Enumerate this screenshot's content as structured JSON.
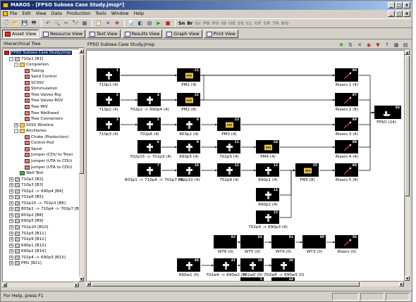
{
  "window": {
    "title": "MAROS - [FPSO Subsea Case Study.jmsp*]",
    "min": "_",
    "max": "□",
    "close": "x"
  },
  "menu": [
    "File",
    "Edit",
    "View",
    "Data",
    "Production",
    "Tools",
    "Window",
    "Help"
  ],
  "toolbar": {
    "icons": [
      "new-icon",
      "open-icon",
      "save-icon",
      "print-icon",
      "back-icon",
      "print-preview-icon",
      "cut-icon",
      "find-icon",
      "table-icon",
      "paste-icon",
      "tools-icon",
      "cross-icon",
      "chart-icon",
      "split-icon",
      "stack-icon",
      "run-icon",
      "stop-icon"
    ],
    "text_buttons": [
      {
        "label": "Sn",
        "enabled": true
      },
      {
        "label": "Br",
        "enabled": true
      },
      {
        "label": "Gr",
        "enabled": false
      },
      {
        "label": "PB",
        "enabled": false
      },
      {
        "label": "PU",
        "enabled": false
      },
      {
        "label": "IB",
        "enabled": false
      },
      {
        "label": "UE",
        "enabled": false
      },
      {
        "label": "SE",
        "enabled": false
      },
      {
        "label": "CL",
        "enabled": false
      },
      {
        "label": "UF",
        "enabled": false
      },
      {
        "label": "SR",
        "enabled": false
      },
      {
        "label": "TR",
        "enabled": false
      },
      {
        "label": "BO",
        "enabled": false
      }
    ]
  },
  "tabs": [
    "Asset View",
    "Resource View",
    "Text View",
    "Results View",
    "Graph View",
    "Print View"
  ],
  "active_tab": "Asset View",
  "left_pane": {
    "header": "Hierarchical Tree",
    "items": [
      {
        "label": "FPSO Subsea Case Study.jmsp",
        "indent": 0,
        "icon": "root",
        "expander": "",
        "selected": true
      },
      {
        "label": "710p1 [B1]",
        "indent": 1,
        "icon": "well",
        "expander": "-"
      },
      {
        "label": "Completion",
        "indent": 2,
        "icon": "fold",
        "expander": "-"
      },
      {
        "label": "Tubing",
        "indent": 3,
        "icon": "item",
        "expander": ""
      },
      {
        "label": "Sand Control",
        "indent": 3,
        "icon": "item",
        "expander": ""
      },
      {
        "label": "SCSSV",
        "indent": 3,
        "icon": "item",
        "expander": ""
      },
      {
        "label": "Stimmulation",
        "indent": 3,
        "icon": "item",
        "expander": ""
      },
      {
        "label": "Tree Valves Rig",
        "indent": 3,
        "icon": "item",
        "expander": ""
      },
      {
        "label": "Tree Valves ROV",
        "indent": 3,
        "icon": "item",
        "expander": ""
      },
      {
        "label": "Tree MIV",
        "indent": 3,
        "icon": "item",
        "expander": ""
      },
      {
        "label": "Tree Wellhead",
        "indent": 3,
        "icon": "item",
        "expander": ""
      },
      {
        "label": "Tree Connectors",
        "indent": 3,
        "icon": "item",
        "expander": ""
      },
      {
        "label": "SSSV Wireline",
        "indent": 2,
        "icon": "fold",
        "expander": "+"
      },
      {
        "label": "Ancillaries",
        "indent": 2,
        "icon": "fold",
        "expander": "-"
      },
      {
        "label": "Choke (Production)",
        "indent": 3,
        "icon": "item",
        "expander": ""
      },
      {
        "label": "Control Pod",
        "indent": 3,
        "icon": "item",
        "expander": ""
      },
      {
        "label": "Spool",
        "indent": 3,
        "icon": "item",
        "expander": ""
      },
      {
        "label": "Jumper (CDU to Tree)",
        "indent": 3,
        "icon": "item",
        "expander": ""
      },
      {
        "label": "Jumper (UTA to CDU)",
        "indent": 3,
        "icon": "item",
        "expander": ""
      },
      {
        "label": "Jumper (UTA to CDU)",
        "indent": 3,
        "icon": "item",
        "expander": ""
      },
      {
        "label": "Well Test",
        "indent": 2,
        "icon": "test",
        "expander": ""
      },
      {
        "label": "710p2 [B2]",
        "indent": 1,
        "icon": "well",
        "expander": "+"
      },
      {
        "label": "710p3 [B3]",
        "indent": 1,
        "icon": "well",
        "expander": "+"
      },
      {
        "label": "702p2 -> 690p4 [B4]",
        "indent": 1,
        "icon": "well",
        "expander": "+"
      },
      {
        "label": "702p6 [B5]",
        "indent": 1,
        "icon": "well",
        "expander": "+"
      },
      {
        "label": "702p15 -> 702p3 [B6]",
        "indent": 1,
        "icon": "well",
        "expander": "+"
      },
      {
        "label": "803p1 -> 710p4 -> 702p7 [B7",
        "indent": 1,
        "icon": "well",
        "expander": "+"
      },
      {
        "label": "803p2 [B8]",
        "indent": 1,
        "icon": "well",
        "expander": "+"
      },
      {
        "label": "690p5 [B9]",
        "indent": 1,
        "icon": "well",
        "expander": "+"
      },
      {
        "label": "702p10 [B10]",
        "indent": 1,
        "icon": "well",
        "expander": "+"
      },
      {
        "label": "702p5 [B11]",
        "indent": 1,
        "icon": "well",
        "expander": "+"
      },
      {
        "label": "702p9 [B12]",
        "indent": 1,
        "icon": "well",
        "expander": "+"
      },
      {
        "label": "690p1 [B13]",
        "indent": 1,
        "icon": "well",
        "expander": "+"
      },
      {
        "label": "690p2 [B14]",
        "indent": 1,
        "icon": "well",
        "expander": "+"
      },
      {
        "label": "702p4 -> 690p3 [B15]",
        "indent": 1,
        "icon": "well",
        "expander": "+"
      },
      {
        "label": "PM1 [B21]",
        "indent": 1,
        "icon": "well",
        "expander": "+"
      }
    ]
  },
  "right_pane": {
    "header": "FPSO Subsea Case Study.jmsp",
    "icons": [
      "green-x-icon",
      "sort-icon",
      "tools-icon",
      "help-icon",
      "red-down-icon",
      "up-icon",
      "grid-icon",
      "list-icon"
    ]
  },
  "nodes": [
    {
      "id": "n710p1",
      "badge": "1",
      "label": "710p1 (4)",
      "kind": "well"
    },
    {
      "id": "nPM1",
      "badge": "21",
      "label": "PM1 (4)",
      "kind": "manifold"
    },
    {
      "id": "nR1",
      "badge": "80",
      "label": "Risers 1 (4)",
      "kind": "riser"
    },
    {
      "id": "n710p2",
      "badge": "2",
      "label": "710p2 (4)",
      "kind": "well"
    },
    {
      "id": "n702p2",
      "badge": "4",
      "label": "702p2 -> 690p4 (4)",
      "kind": "well"
    },
    {
      "id": "nPM2",
      "badge": "22",
      "label": "PM2 (8)",
      "kind": "manifold"
    },
    {
      "id": "nR2",
      "badge": "87",
      "label": "Risers 2 (8)",
      "kind": "riser"
    },
    {
      "id": "n710p3",
      "badge": "3",
      "label": "710p3 (4)",
      "kind": "well"
    },
    {
      "id": "n702p6",
      "badge": "5",
      "label": "702p6 (4)",
      "kind": "well"
    },
    {
      "id": "n803p2",
      "badge": "8",
      "label": "803p2 (4)",
      "kind": "well"
    },
    {
      "id": "nPM3",
      "badge": "23",
      "label": "PM3 (4)",
      "kind": "manifold"
    },
    {
      "id": "nR3",
      "badge": "88",
      "label": "Risers 3 (4)",
      "kind": "riser"
    },
    {
      "id": "nFPSO",
      "badge": "84",
      "label": "FPSO (24)",
      "kind": "fpso"
    },
    {
      "id": "n702p15",
      "badge": "6",
      "label": "702p15 -> 702p3 (4)",
      "kind": "well"
    },
    {
      "id": "n690p5",
      "badge": "9",
      "label": "690p5 (4)",
      "kind": "well"
    },
    {
      "id": "n702p5",
      "badge": "11",
      "label": "702p5 (4)",
      "kind": "well"
    },
    {
      "id": "nPM4",
      "badge": "24",
      "label": "PM4 (4)",
      "kind": "manifold"
    },
    {
      "id": "nR4",
      "badge": "89",
      "label": "Risers 4 (4)",
      "kind": "riser"
    },
    {
      "id": "n803p1",
      "badge": "7",
      "label": "803p1 -> 710p4 -> 702p7 (4)",
      "kind": "well"
    },
    {
      "id": "n702p10",
      "badge": "10",
      "label": "702p10 (4)",
      "kind": "well"
    },
    {
      "id": "n702p9",
      "badge": "12",
      "label": "702p9 (4)",
      "kind": "well"
    },
    {
      "id": "n690p1",
      "badge": "13",
      "label": "690p1 (4)",
      "kind": "well"
    },
    {
      "id": "nPM5",
      "badge": "25",
      "label": "PM5 (8)",
      "kind": "manifold"
    },
    {
      "id": "nR5",
      "badge": "90",
      "label": "Risers 5 (8)",
      "kind": "riser"
    },
    {
      "id": "n690p2",
      "badge": "14",
      "label": "690p2 (4)",
      "kind": "well"
    },
    {
      "id": "n702p4",
      "badge": "15",
      "label": "702p4 -> 690p3 (4)",
      "kind": "well"
    },
    {
      "id": "nWT6",
      "badge": "92",
      "label": "WT6 (0)",
      "kind": "empty"
    },
    {
      "id": "nWT5",
      "badge": "92",
      "label": "WT5 (0)",
      "kind": "empty"
    },
    {
      "id": "nWT4",
      "badge": "91",
      "label": "WT4 (0)",
      "kind": "empty"
    },
    {
      "id": "nWT3",
      "badge": "90",
      "label": "WT3 (0)",
      "kind": "empty"
    },
    {
      "id": "nRisers0",
      "badge": "56",
      "label": "Risers (0)",
      "kind": "riser"
    },
    {
      "id": "n690w1",
      "badge": "40",
      "label": "690w1 (0)",
      "kind": "well"
    },
    {
      "id": "n702w4",
      "badge": "41",
      "label": "702w4 -> 690w2 (0)",
      "kind": "well"
    },
    {
      "id": "n702w5",
      "badge": "39",
      "label": "702w5 (0)",
      "kind": "well"
    },
    {
      "id": "n702w6",
      "badge": "38",
      "label": "702w6 -> 690w5 (0)",
      "kind": "well"
    },
    {
      "id": "nB1",
      "badge": "5",
      "label": "",
      "kind": "well"
    },
    {
      "id": "nB2",
      "badge": "44",
      "label": "",
      "kind": "well"
    }
  ],
  "status": {
    "text": "For Help, press F1"
  }
}
